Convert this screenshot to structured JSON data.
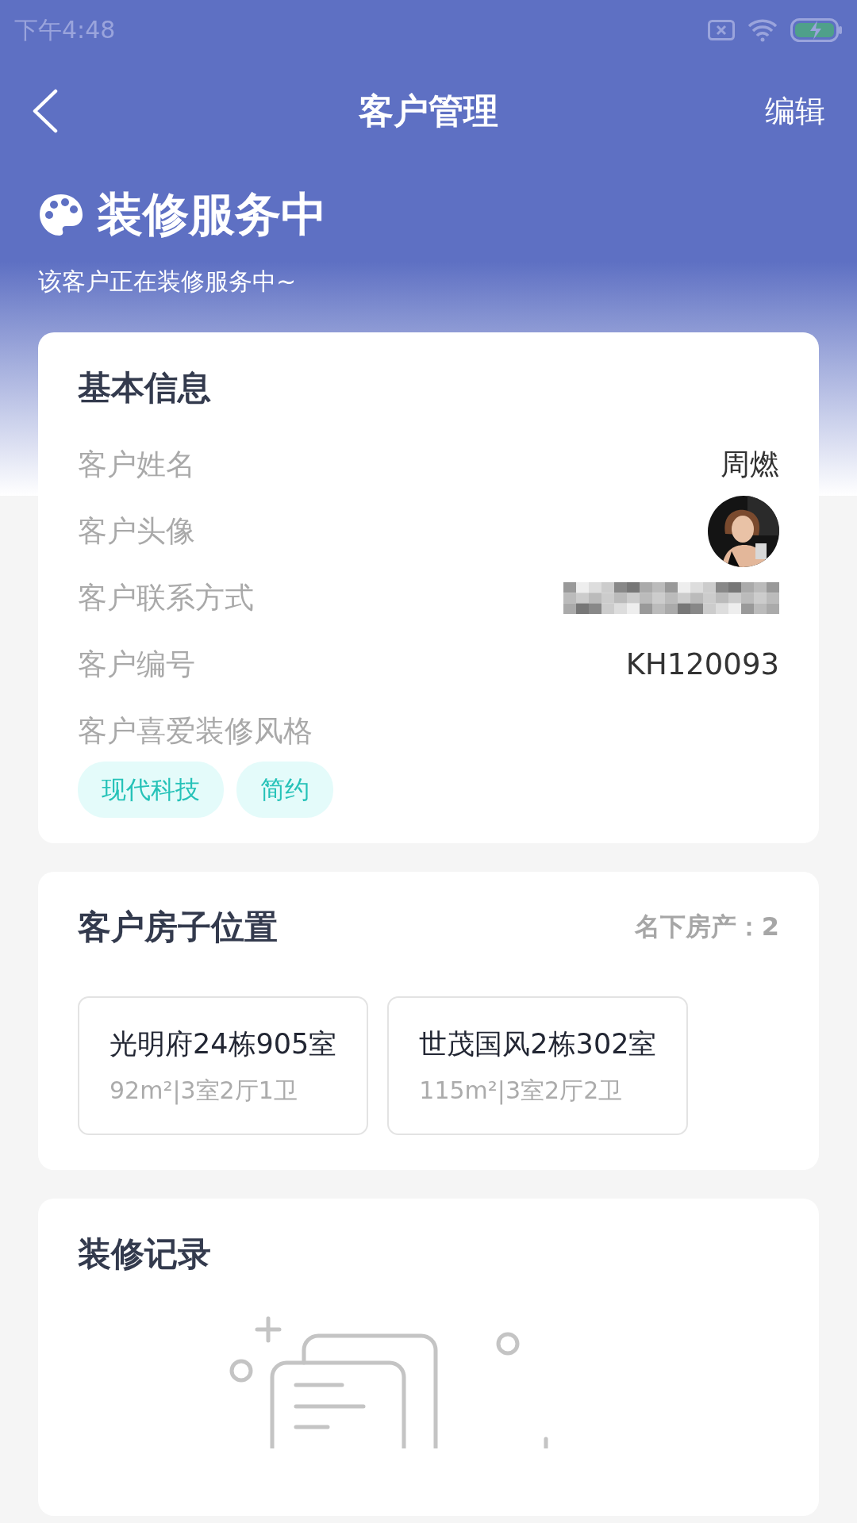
{
  "status_bar": {
    "time": "下午4:48"
  },
  "header": {
    "title": "客户管理",
    "action": "编辑"
  },
  "banner": {
    "title": "装修服务中",
    "subtitle": "该客户正在装修服务中~"
  },
  "basic_info": {
    "title": "基本信息",
    "rows": [
      {
        "label": "客户姓名",
        "kind": "text",
        "value": "周燃"
      },
      {
        "label": "客户头像",
        "kind": "avatar"
      },
      {
        "label": "客户联系方式",
        "kind": "redacted"
      },
      {
        "label": "客户编号",
        "kind": "text",
        "value": "KH120093"
      },
      {
        "label": "客户喜爱装修风格",
        "kind": "tags",
        "tags": [
          "现代科技",
          "简约"
        ]
      }
    ]
  },
  "houses": {
    "title": "客户房子位置",
    "count_label": "名下房产：2",
    "items": [
      {
        "name": "光明府24栋905室",
        "detail": "92m²|3室2厅1卫"
      },
      {
        "name": "世茂国风2栋302室",
        "detail": "115m²|3室2厅2卫"
      }
    ]
  },
  "records": {
    "title": "装修记录"
  }
}
